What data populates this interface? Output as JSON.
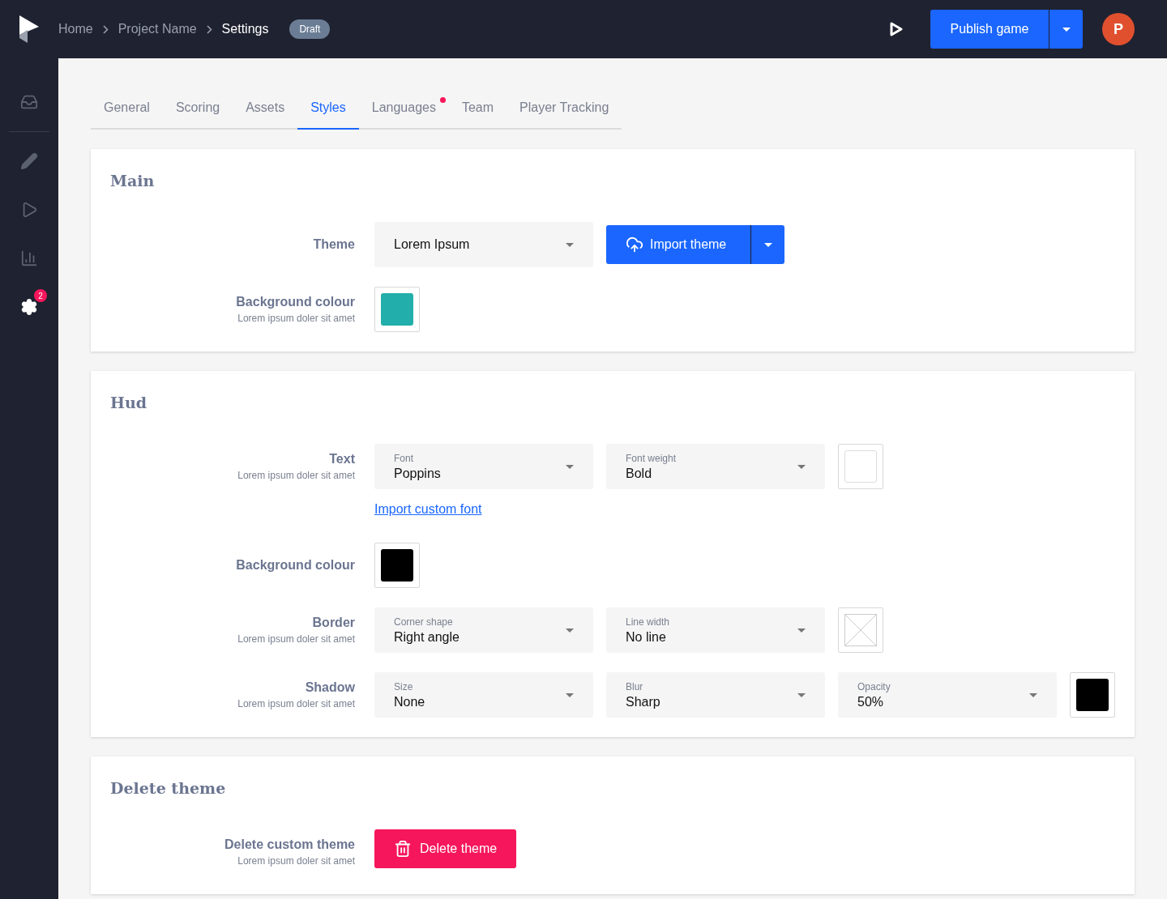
{
  "header": {
    "breadcrumbs": [
      {
        "label": "Home",
        "current": false
      },
      {
        "label": "Project Name",
        "current": false
      },
      {
        "label": "Settings",
        "current": true
      }
    ],
    "status_badge": "Draft",
    "publish_button": "Publish game",
    "avatar": "P"
  },
  "sidebar": {
    "items": [
      {
        "selected": false
      },
      {
        "selected": false
      },
      {
        "selected": false
      },
      {
        "selected": false
      },
      {
        "selected": true,
        "badge": "2"
      }
    ]
  },
  "tabs": [
    {
      "label": "General",
      "selected": false,
      "notification": false
    },
    {
      "label": "Scoring",
      "selected": false,
      "notification": false
    },
    {
      "label": "Assets",
      "selected": false,
      "notification": false
    },
    {
      "label": "Styles",
      "selected": true,
      "notification": false
    },
    {
      "label": "Languages",
      "selected": false,
      "notification": true
    },
    {
      "label": "Team",
      "selected": false,
      "notification": false
    },
    {
      "label": "Player Tracking",
      "selected": false,
      "notification": false
    }
  ],
  "sections": [
    {
      "title": "Main",
      "rows": [
        {
          "label": "Theme",
          "controls": [
            {
              "kind": "select",
              "value": "Lorem Ipsum"
            },
            {
              "kind": "split_button",
              "label": "Import theme"
            }
          ]
        },
        {
          "label": "Background colour",
          "hint": "Lorem ipsum doler sit amet",
          "controls": [
            {
              "kind": "swatch",
              "color": "#22aeaa"
            }
          ]
        }
      ]
    },
    {
      "title": "Hud",
      "rows": [
        {
          "label": "Text",
          "hint": "Lorem ipsum doler sit amet",
          "controls": [
            {
              "kind": "select",
              "label": "Font",
              "value": "Poppins"
            },
            {
              "kind": "select",
              "label": "Font weight",
              "value": "Bold"
            },
            {
              "kind": "swatch",
              "color": "#ffffff"
            }
          ],
          "link": "Import custom font"
        },
        {
          "label": "Background colour",
          "controls": [
            {
              "kind": "swatch",
              "color": "#000000"
            }
          ]
        },
        {
          "label": "Border",
          "hint": "Lorem ipsum doler sit amet",
          "controls": [
            {
              "kind": "select",
              "label": "Corner shape",
              "value": "Right angle"
            },
            {
              "kind": "select",
              "label": "Line width",
              "value": "No line"
            },
            {
              "kind": "swatch_empty"
            }
          ]
        },
        {
          "label": "Shadow",
          "hint": "Lorem ipsum doler sit amet",
          "controls": [
            {
              "kind": "select",
              "label": "Size",
              "value": "None"
            },
            {
              "kind": "select",
              "label": "Blur",
              "value": "Sharp"
            },
            {
              "kind": "select",
              "label": "Opacity",
              "value": "50%"
            },
            {
              "kind": "swatch",
              "color": "#000000"
            }
          ]
        }
      ]
    },
    {
      "title": "Delete theme",
      "rows": [
        {
          "label": "Delete custom theme",
          "hint": "Lorem ipsum doler sit amet",
          "controls": [
            {
              "kind": "danger_button",
              "label": "Delete theme"
            }
          ]
        }
      ]
    }
  ]
}
